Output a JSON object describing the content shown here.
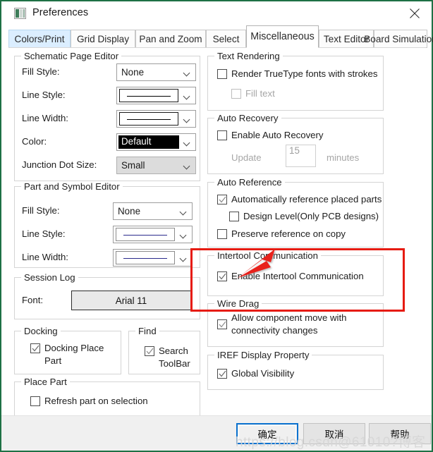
{
  "window": {
    "title": "Preferences",
    "icon": "preferences-icon",
    "close_icon": "close-icon"
  },
  "tabs": [
    {
      "label": "Colors/Print",
      "state": "hover"
    },
    {
      "label": "Grid Display",
      "state": "normal"
    },
    {
      "label": "Pan and Zoom",
      "state": "normal"
    },
    {
      "label": "Select",
      "state": "normal"
    },
    {
      "label": "Miscellaneous",
      "state": "active"
    },
    {
      "label": "Text Editor",
      "state": "normal"
    },
    {
      "label": "Board Simulation",
      "state": "normal"
    }
  ],
  "left": {
    "schematic_page_editor": {
      "legend": "Schematic Page Editor",
      "fill_style_label": "Fill Style:",
      "fill_style_value": "None",
      "line_style_label": "Line Style:",
      "line_style_value": "solid-line-sample",
      "line_width_label": "Line Width:",
      "line_width_value": "thin-line-sample",
      "color_label": "Color:",
      "color_value": "Default",
      "color_swatch_hex": "#000000",
      "junction_dot_label": "Junction Dot Size:",
      "junction_dot_value": "Small"
    },
    "part_and_symbol_editor": {
      "legend": "Part and Symbol Editor",
      "fill_style_label": "Fill Style:",
      "fill_style_value": "None",
      "line_style_label": "Line Style:",
      "line_style_value": "solid-blue-line-sample",
      "line_width_label": "Line Width:",
      "line_width_value": "thin-blue-line-sample"
    },
    "session_log": {
      "legend": "Session Log",
      "font_label": "Font:",
      "font_value": "Arial 11"
    },
    "docking": {
      "legend": "Docking",
      "checkbox_label": "Docking Place Part",
      "checked": true
    },
    "find": {
      "legend": "Find",
      "checkbox_label": "Search ToolBar",
      "checked": true
    },
    "place_part": {
      "legend": "Place Part",
      "checkbox_label": "Refresh part on selection",
      "checked": false
    }
  },
  "right": {
    "text_rendering": {
      "legend": "Text Rendering",
      "render_truetype_label": "Render TrueType fonts with strokes",
      "render_truetype_checked": false,
      "fill_text_label": "Fill text",
      "fill_text_checked": false,
      "fill_text_disabled": true
    },
    "auto_recovery": {
      "legend": "Auto Recovery",
      "enable_label": "Enable Auto Recovery",
      "enable_checked": false,
      "update_label": "Update",
      "interval_value": "15",
      "minutes_label": "minutes",
      "disabled": true
    },
    "auto_reference": {
      "legend": "Auto Reference",
      "auto_ref_label": "Automatically reference placed parts",
      "auto_ref_checked": true,
      "design_level_label": "Design Level(Only PCB designs)",
      "design_level_checked": false,
      "preserve_label": "Preserve reference on copy",
      "preserve_checked": false
    },
    "intertool": {
      "legend": "Intertool Communication",
      "enable_label": "Enable Intertool Communication",
      "enable_checked": true
    },
    "wire_drag": {
      "legend": "Wire Drag",
      "allow_label": "Allow component move with connectivity changes",
      "allow_checked": true
    },
    "iref": {
      "legend": "IREF Display Property",
      "global_visibility_label": "Global Visibility",
      "global_visibility_checked": true
    }
  },
  "footer": {
    "ok_label": "确定",
    "cancel_label": "取消",
    "help_label": "帮助"
  },
  "annotation": {
    "highlight_color": "#e61b12",
    "arrow_target": "enable-intertool-communication-checkbox"
  },
  "watermark": {
    "text": "https://blog.csdn@61010?博客"
  }
}
